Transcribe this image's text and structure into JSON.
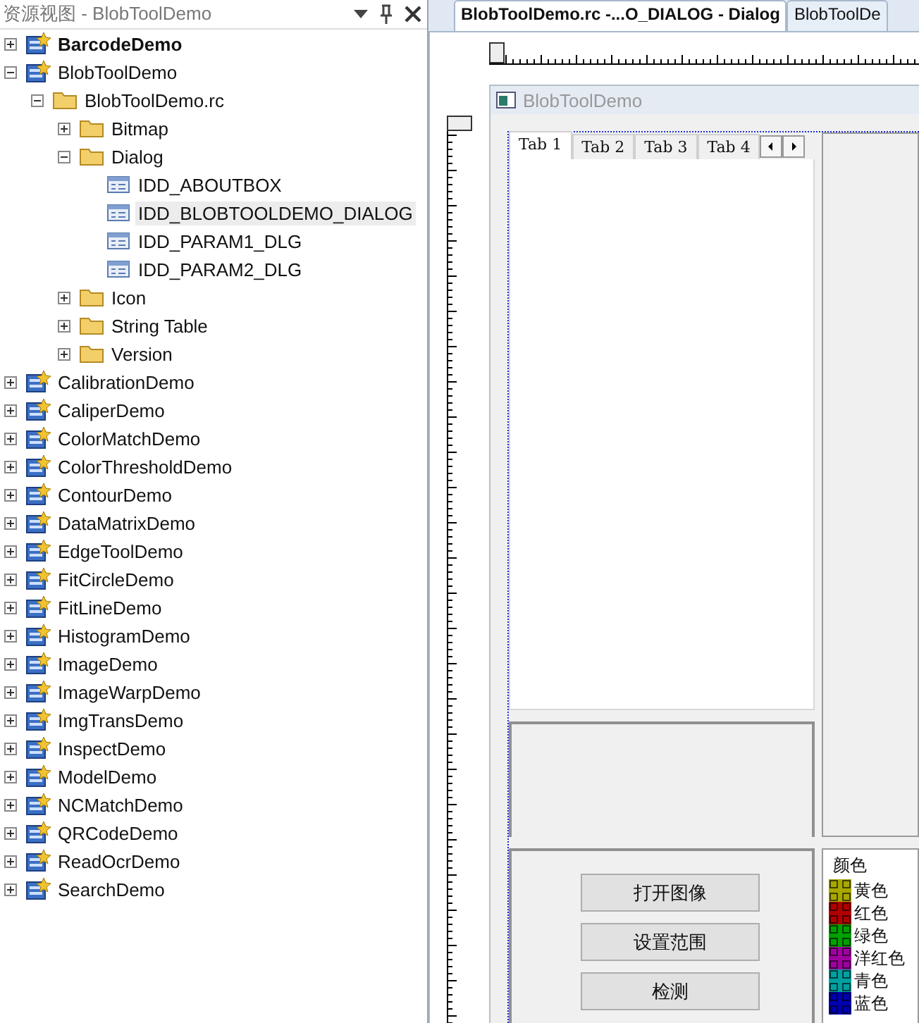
{
  "panel": {
    "title": "资源视图 - BlobToolDemo"
  },
  "tree": [
    {
      "label": "BarcodeDemo",
      "kind": "project",
      "bold": true,
      "expanded": false,
      "selected": false
    },
    {
      "label": "BlobToolDemo",
      "kind": "project",
      "bold": false,
      "expanded": true,
      "selected": false,
      "children": [
        {
          "label": "BlobToolDemo.rc",
          "kind": "folder",
          "expanded": true,
          "selected": false,
          "children": [
            {
              "label": "Bitmap",
              "kind": "folder",
              "expanded": false,
              "selected": false
            },
            {
              "label": "Dialog",
              "kind": "folder",
              "expanded": true,
              "selected": false,
              "children": [
                {
                  "label": "IDD_ABOUTBOX",
                  "kind": "dialog",
                  "selected": false
                },
                {
                  "label": "IDD_BLOBTOOLDEMO_DIALOG",
                  "kind": "dialog",
                  "selected": true
                },
                {
                  "label": "IDD_PARAM1_DLG",
                  "kind": "dialog",
                  "selected": false
                },
                {
                  "label": "IDD_PARAM2_DLG",
                  "kind": "dialog",
                  "selected": false
                }
              ]
            },
            {
              "label": "Icon",
              "kind": "folder",
              "expanded": false,
              "selected": false
            },
            {
              "label": "String Table",
              "kind": "folder",
              "expanded": false,
              "selected": false
            },
            {
              "label": "Version",
              "kind": "folder",
              "expanded": false,
              "selected": false
            }
          ]
        }
      ]
    },
    {
      "label": "CalibrationDemo",
      "kind": "project",
      "bold": false,
      "expanded": false,
      "selected": false
    },
    {
      "label": "CaliperDemo",
      "kind": "project",
      "bold": false,
      "expanded": false,
      "selected": false
    },
    {
      "label": "ColorMatchDemo",
      "kind": "project",
      "bold": false,
      "expanded": false,
      "selected": false
    },
    {
      "label": "ColorThresholdDemo",
      "kind": "project",
      "bold": false,
      "expanded": false,
      "selected": false
    },
    {
      "label": "ContourDemo",
      "kind": "project",
      "bold": false,
      "expanded": false,
      "selected": false
    },
    {
      "label": "DataMatrixDemo",
      "kind": "project",
      "bold": false,
      "expanded": false,
      "selected": false
    },
    {
      "label": "EdgeToolDemo",
      "kind": "project",
      "bold": false,
      "expanded": false,
      "selected": false
    },
    {
      "label": "FitCircleDemo",
      "kind": "project",
      "bold": false,
      "expanded": false,
      "selected": false
    },
    {
      "label": "FitLineDemo",
      "kind": "project",
      "bold": false,
      "expanded": false,
      "selected": false
    },
    {
      "label": "HistogramDemo",
      "kind": "project",
      "bold": false,
      "expanded": false,
      "selected": false
    },
    {
      "label": "ImageDemo",
      "kind": "project",
      "bold": false,
      "expanded": false,
      "selected": false
    },
    {
      "label": "ImageWarpDemo",
      "kind": "project",
      "bold": false,
      "expanded": false,
      "selected": false
    },
    {
      "label": "ImgTransDemo",
      "kind": "project",
      "bold": false,
      "expanded": false,
      "selected": false
    },
    {
      "label": "InspectDemo",
      "kind": "project",
      "bold": false,
      "expanded": false,
      "selected": false
    },
    {
      "label": "ModelDemo",
      "kind": "project",
      "bold": false,
      "expanded": false,
      "selected": false
    },
    {
      "label": "NCMatchDemo",
      "kind": "project",
      "bold": false,
      "expanded": false,
      "selected": false
    },
    {
      "label": "QRCodeDemo",
      "kind": "project",
      "bold": false,
      "expanded": false,
      "selected": false
    },
    {
      "label": "ReadOcrDemo",
      "kind": "project",
      "bold": false,
      "expanded": false,
      "selected": false
    },
    {
      "label": "SearchDemo",
      "kind": "project",
      "bold": false,
      "expanded": false,
      "selected": false
    }
  ],
  "doc_tabs": [
    {
      "label": "BlobToolDemo.rc -...O_DIALOG - Dialog",
      "selected": true
    },
    {
      "label": "BlobToolDe",
      "selected": false
    }
  ],
  "dialog": {
    "title": "BlobToolDemo",
    "tabs": [
      {
        "label": "Tab 1",
        "selected": true
      },
      {
        "label": "Tab 2",
        "selected": false
      },
      {
        "label": "Tab 3",
        "selected": false
      },
      {
        "label": "Tab 4",
        "selected": false
      }
    ],
    "buttons": [
      "打开图像",
      "设置范围",
      "检测"
    ],
    "color_list": {
      "header": "颜色",
      "items": [
        {
          "label": "黄色",
          "color": "#a8a800"
        },
        {
          "label": "红色",
          "color": "#b00000"
        },
        {
          "label": "绿色",
          "color": "#00a000"
        },
        {
          "label": "洋红色",
          "color": "#a000a0"
        },
        {
          "label": "青色",
          "color": "#00a0a0"
        },
        {
          "label": "蓝色",
          "color": "#0000b0"
        }
      ]
    }
  }
}
